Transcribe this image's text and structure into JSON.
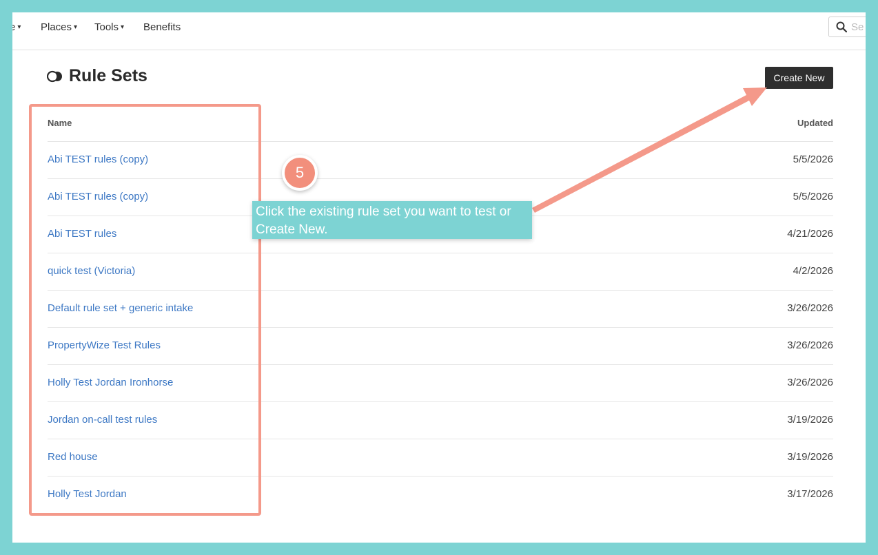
{
  "nav": {
    "items": [
      {
        "label": "e",
        "caret": "▾"
      },
      {
        "label": "Places",
        "caret": "▾"
      },
      {
        "label": "Tools",
        "caret": "▾"
      },
      {
        "label": "Benefits",
        "caret": ""
      }
    ],
    "search_placeholder": "Se"
  },
  "page": {
    "title": "Rule Sets",
    "create_button": "Create New"
  },
  "table": {
    "headers": {
      "name": "Name",
      "updated": "Updated"
    },
    "rows": [
      {
        "name": "Abi TEST rules (copy)",
        "updated": "5/5/2026"
      },
      {
        "name": "Abi TEST rules (copy)",
        "updated": "5/5/2026"
      },
      {
        "name": "Abi TEST rules",
        "updated": "4/21/2026"
      },
      {
        "name": "quick test (Victoria)",
        "updated": "4/2/2026"
      },
      {
        "name": "Default rule set + generic intake",
        "updated": "3/26/2026"
      },
      {
        "name": "PropertyWize Test Rules",
        "updated": "3/26/2026"
      },
      {
        "name": "Holly Test Jordan Ironhorse",
        "updated": "3/26/2026"
      },
      {
        "name": "Jordan on-call test rules",
        "updated": "3/19/2026"
      },
      {
        "name": "Red house",
        "updated": "3/19/2026"
      },
      {
        "name": "Holly Test Jordan",
        "updated": "3/17/2026"
      }
    ]
  },
  "annotation": {
    "step": "5",
    "text": "Click the existing rule set you want to test or Create New.",
    "colors": {
      "highlight": "#f4998a",
      "tooltip": "#7dd3d3",
      "step": "#f28f7c"
    }
  }
}
